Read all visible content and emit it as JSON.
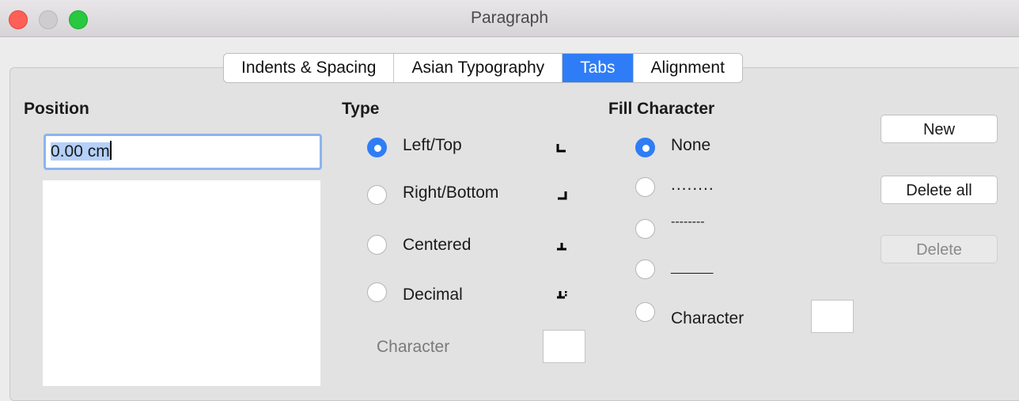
{
  "window": {
    "title": "Paragraph"
  },
  "tabs": [
    {
      "label": "Indents & Spacing",
      "active": false
    },
    {
      "label": "Asian Typography",
      "active": false
    },
    {
      "label": "Tabs",
      "active": true
    },
    {
      "label": "Alignment",
      "active": false
    }
  ],
  "position": {
    "heading": "Position",
    "value": "0.00 cm",
    "list_items": []
  },
  "type": {
    "heading": "Type",
    "options": [
      {
        "label": "Left/Top",
        "checked": true,
        "icon": "tab-left-icon"
      },
      {
        "label": "Right/Bottom",
        "checked": false,
        "icon": "tab-right-icon"
      },
      {
        "label": "Centered",
        "checked": false,
        "icon": "tab-center-icon"
      },
      {
        "label": "Decimal",
        "checked": false,
        "icon": "tab-decimal-icon"
      }
    ],
    "character_label": "Character",
    "character_value": ""
  },
  "fill": {
    "heading": "Fill Character",
    "options": [
      {
        "label": "None",
        "checked": true
      },
      {
        "label": "........",
        "checked": false
      },
      {
        "label": "--------",
        "checked": false
      },
      {
        "label": "______",
        "checked": false
      },
      {
        "label": "Character",
        "checked": false
      }
    ],
    "character_value": ""
  },
  "buttons": {
    "new": "New",
    "delete_all": "Delete all",
    "delete": "Delete"
  },
  "colors": {
    "accent": "#2f7df6",
    "window_bg": "#ececec",
    "panel_bg": "#e2e2e2"
  }
}
